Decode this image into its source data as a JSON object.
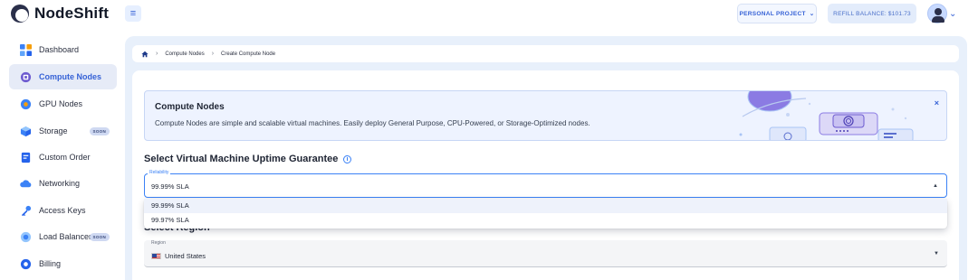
{
  "app": {
    "brand": "NodeShift"
  },
  "topbar": {
    "project_label": "PERSONAL PROJECT",
    "refill_label": "REFILL BALANCE: $101.73"
  },
  "sidebar": {
    "items": [
      {
        "label": "Dashboard",
        "icon": "dashboard-icon"
      },
      {
        "label": "Compute Nodes",
        "icon": "chip-icon",
        "active": true
      },
      {
        "label": "GPU Nodes",
        "icon": "gpu-icon"
      },
      {
        "label": "Storage",
        "icon": "storage-icon",
        "badge": "SOON"
      },
      {
        "label": "Custom Order",
        "icon": "document-icon"
      },
      {
        "label": "Networking",
        "icon": "cloud-icon"
      },
      {
        "label": "Access Keys",
        "icon": "key-icon"
      },
      {
        "label": "Load Balancer",
        "icon": "balancer-icon",
        "badge": "SOON"
      },
      {
        "label": "Billing",
        "icon": "billing-icon"
      }
    ]
  },
  "breadcrumb": {
    "items": [
      "Compute Nodes",
      "Create Compute Node"
    ]
  },
  "banner": {
    "title": "Compute Nodes",
    "description": "Compute Nodes are simple and scalable virtual machines. Easily deploy General Purpose, CPU-Powered, or Storage-Optimized nodes.",
    "close": "×"
  },
  "uptime": {
    "title": "Select Virtual Machine Uptime Guarantee",
    "field_label": "Reliability",
    "value": "99.99% SLA",
    "options": [
      "99.99% SLA",
      "99.97% SLA"
    ]
  },
  "region": {
    "title": "Select Region",
    "field_label": "Region",
    "value": "United States"
  },
  "colors": {
    "accent": "#3561d6",
    "main_bg": "#e8f0fb"
  }
}
